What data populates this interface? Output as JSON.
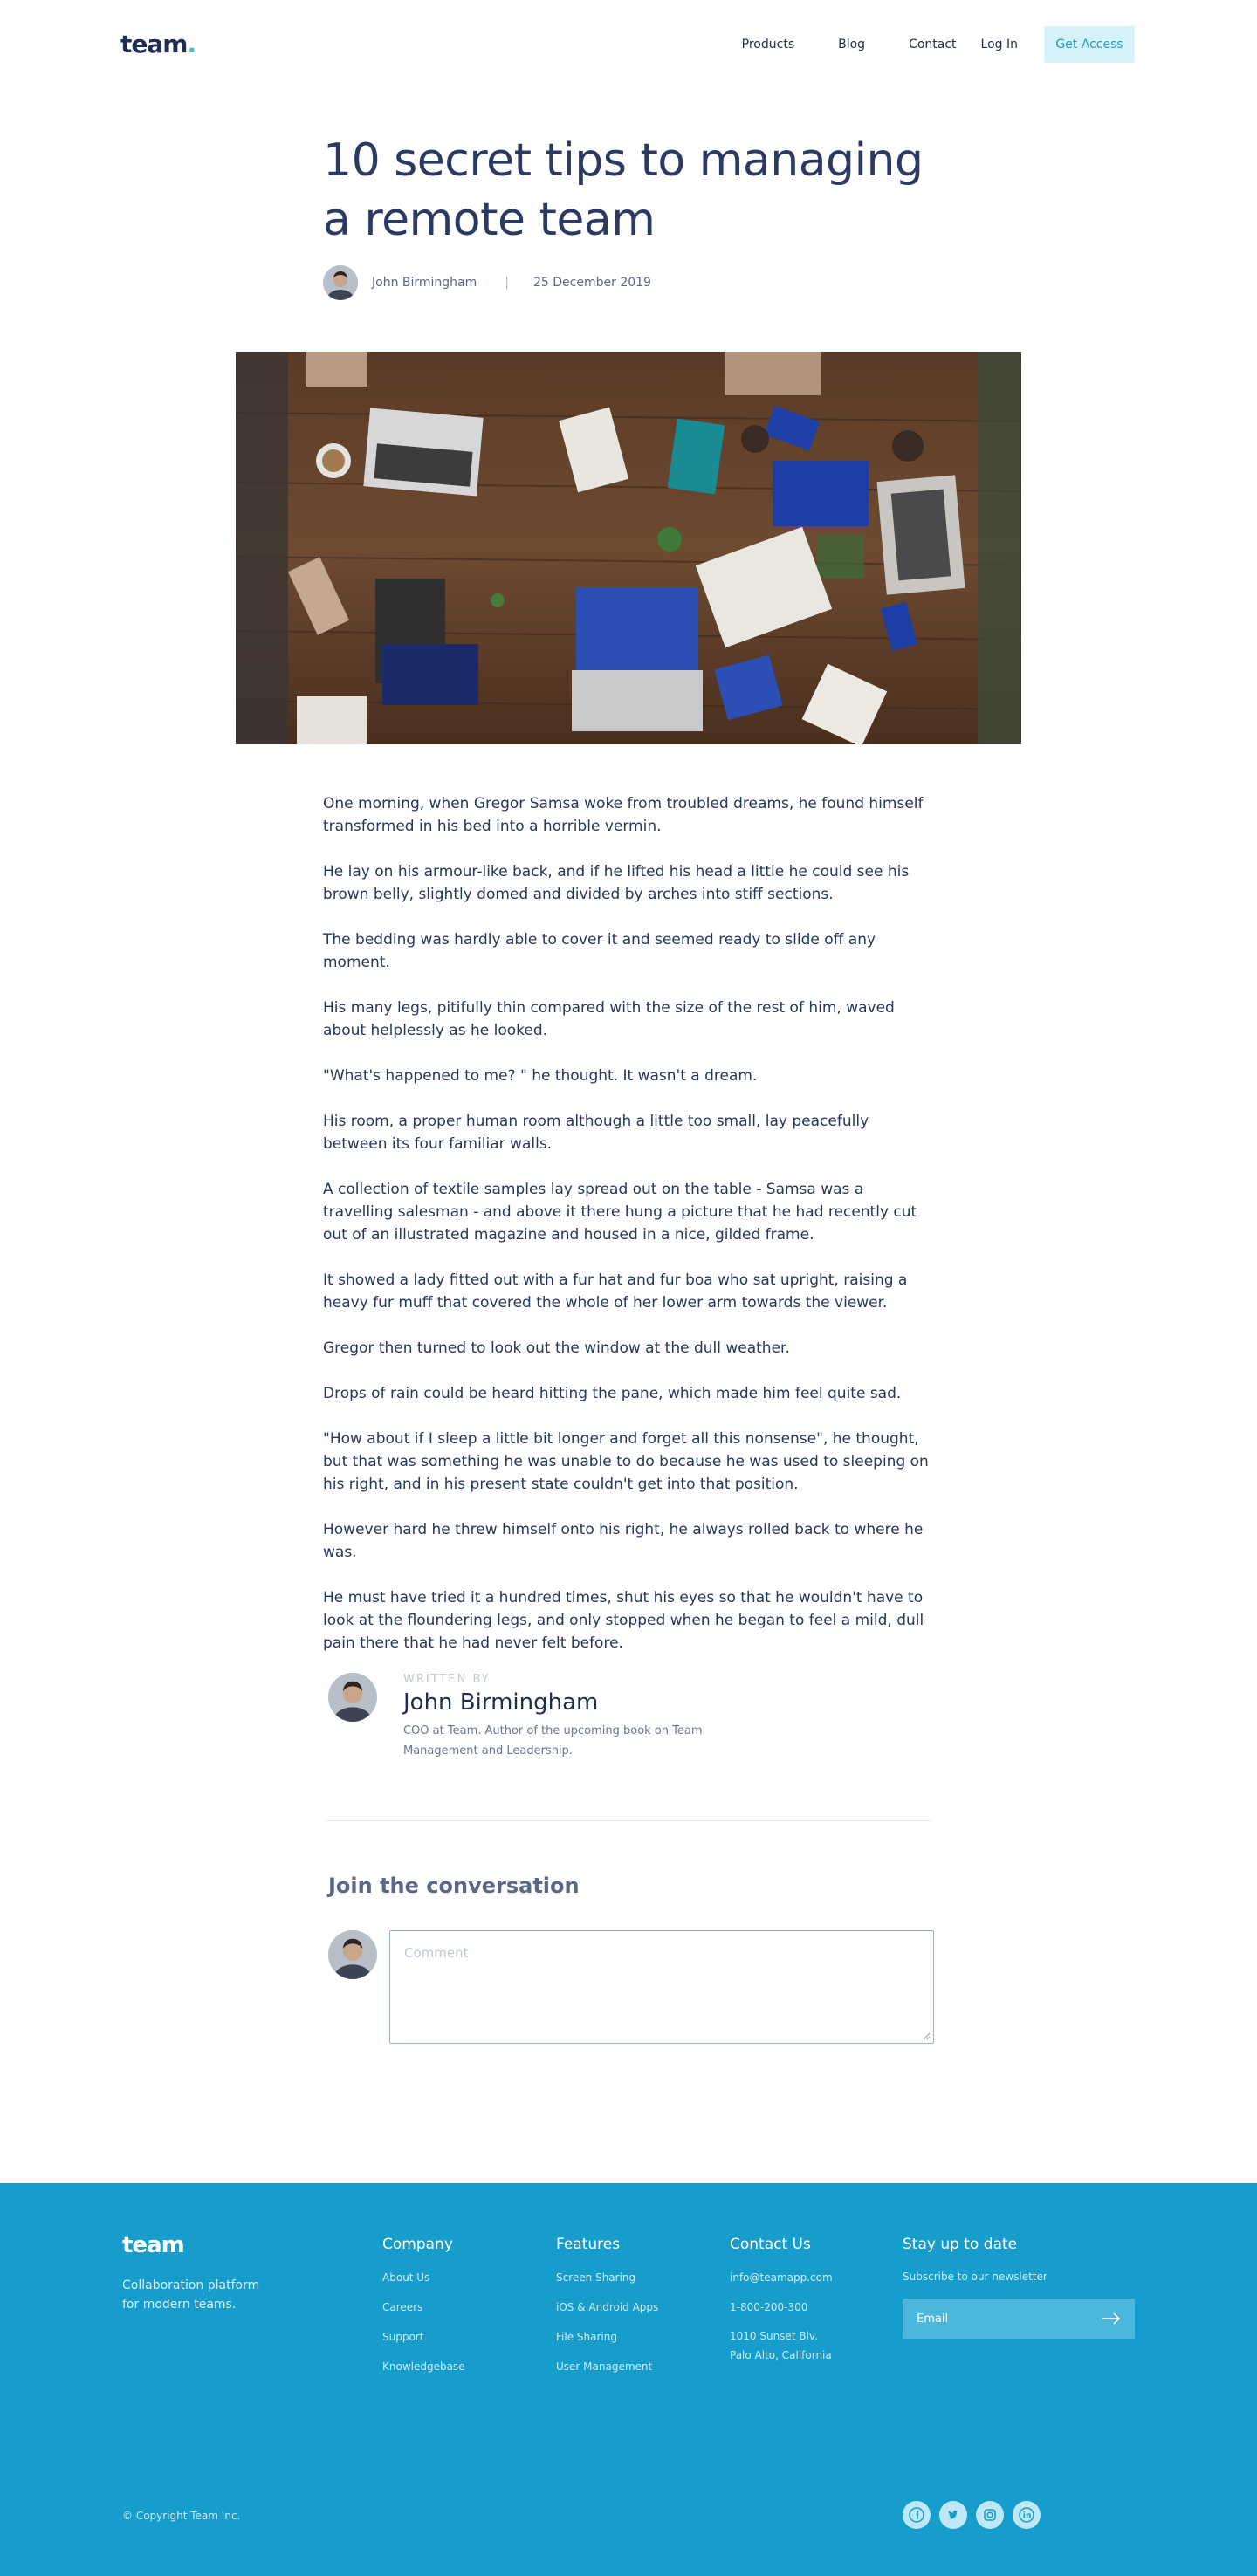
{
  "header": {
    "logo": "team",
    "logo_dot": ".",
    "nav": [
      "Products",
      "Blog",
      "Contact"
    ],
    "login": "Log In",
    "cta": "Get Access"
  },
  "article": {
    "title": "10 secret tips to managing a remote team",
    "author": "John Birmingham",
    "separator": "|",
    "date": "25 December 2019",
    "hero_image": "office-desk-teamwork-photo",
    "paragraphs": [
      "One morning, when Gregor Samsa woke from troubled dreams, he found himself transformed in his bed into a horrible vermin.",
      "He lay on his armour-like back, and if he lifted his head a little he could see his brown belly, slightly domed and divided by arches into stiff sections.",
      "The bedding was hardly able to cover it and seemed ready to slide off any moment.",
      "His many legs, pitifully thin compared with the size of the rest of him, waved about helplessly as he looked.",
      "\"What's happened to me? \" he thought. It wasn't a dream.",
      "His room, a proper human room although a little too small, lay peacefully between its four familiar walls.",
      "A collection of textile samples lay spread out on the table - Samsa was a travelling salesman - and above it there hung a picture that he had recently cut out of an illustrated magazine and housed in a nice, gilded frame.",
      "It showed a lady fitted out with a fur hat and fur boa who sat upright, raising a heavy fur muff that covered the whole of her lower arm towards the viewer.",
      "Gregor then turned to look out the window at the dull weather.",
      "Drops of rain could be heard hitting the pane, which made him feel quite sad.",
      "\"How about if I sleep a little bit longer and forget all this nonsense\", he thought, but that was something he was unable to do because he was used to sleeping on his right, and in his present state couldn't get into that position.",
      "However hard he threw himself onto his right, he always rolled back to where he was.",
      "He must have tried it a hundred times, shut his eyes so that he wouldn't have to look at the floundering legs, and only stopped when he began to feel a mild, dull pain there that he had never felt before."
    ]
  },
  "author_box": {
    "label": "WRITTEN BY",
    "name": "John Birmingham",
    "bio": "COO at Team. Author of the upcoming book on Team Management and Leadership."
  },
  "comments": {
    "title": "Join the conversation",
    "placeholder": "Comment"
  },
  "footer": {
    "logo": "team",
    "tagline": "Collaboration platform for modern teams.",
    "columns": [
      {
        "title": "Company",
        "items": [
          "About Us",
          "Careers",
          "Support",
          "Knowledgebase"
        ]
      },
      {
        "title": "Features",
        "items": [
          "Screen Sharing",
          "iOS & Android Apps",
          "File Sharing",
          "User Management"
        ]
      },
      {
        "title": "Contact Us",
        "items": [
          "info@teamapp.com",
          "1-800-200-300",
          "1010 Sunset Blv.\nPalo Alto, California"
        ]
      }
    ],
    "newsletter": {
      "title": "Stay up to date",
      "subtitle": "Subscribe to our newsletter",
      "email_placeholder": "Email"
    },
    "copyright": "© Copyright Team Inc.",
    "socials": [
      "facebook-icon",
      "twitter-icon",
      "instagram-icon",
      "linkedin-icon"
    ]
  },
  "colors": {
    "primary": "#25345a",
    "accent": "#4db8e0",
    "cta_bg": "#d6f3fc",
    "footer_bg": "#169dcb"
  }
}
